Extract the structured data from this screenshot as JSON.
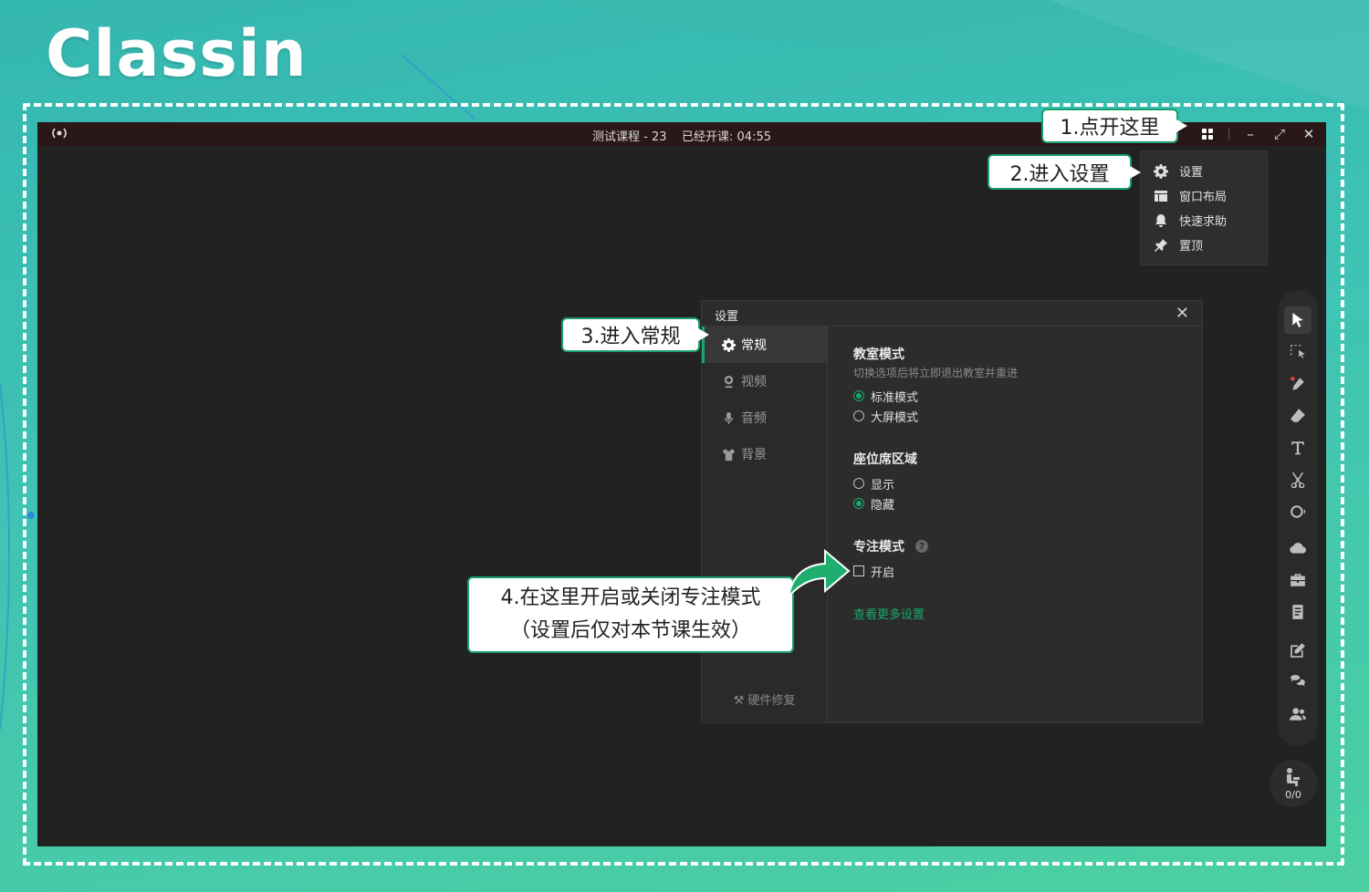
{
  "logo": "Classin",
  "titlebar": {
    "title": "测试课程 - 23",
    "elapsed": "已经开课: 04:55"
  },
  "dropdown": {
    "items": [
      {
        "label": "设置",
        "icon": "gear-icon"
      },
      {
        "label": "窗口布局",
        "icon": "layout-icon"
      },
      {
        "label": "快速求助",
        "icon": "bell-icon"
      },
      {
        "label": "置顶",
        "icon": "pin-icon"
      }
    ]
  },
  "settings": {
    "title": "设置",
    "sidebar": [
      {
        "label": "常规",
        "icon": "gear-icon",
        "active": true
      },
      {
        "label": "视频",
        "icon": "camera-icon"
      },
      {
        "label": "音频",
        "icon": "mic-icon"
      },
      {
        "label": "背景",
        "icon": "shirt-icon"
      }
    ],
    "hardware_fix": "硬件修复",
    "classroom_mode": {
      "title": "教室模式",
      "desc": "切换选项后将立即退出教室并重进",
      "options": [
        "标准模式",
        "大屏模式"
      ],
      "selected": "标准模式"
    },
    "seat_area": {
      "title": "座位席区域",
      "options": [
        "显示",
        "隐藏"
      ],
      "selected": "隐藏"
    },
    "focus_mode": {
      "title": "专注模式",
      "option": "开启",
      "checked": false
    },
    "more_link": "查看更多设置"
  },
  "seat_counter": "0/0",
  "callouts": {
    "c1": "1.点开这里",
    "c2": "2.进入设置",
    "c3": "3.进入常规",
    "c4_line1": "4.在这里开启或关闭专注模式",
    "c4_line2": "（设置后仅对本节课生效）"
  },
  "colors": {
    "accent": "#18a86b",
    "background": "#3fc3b4",
    "app_bg": "#222222"
  }
}
